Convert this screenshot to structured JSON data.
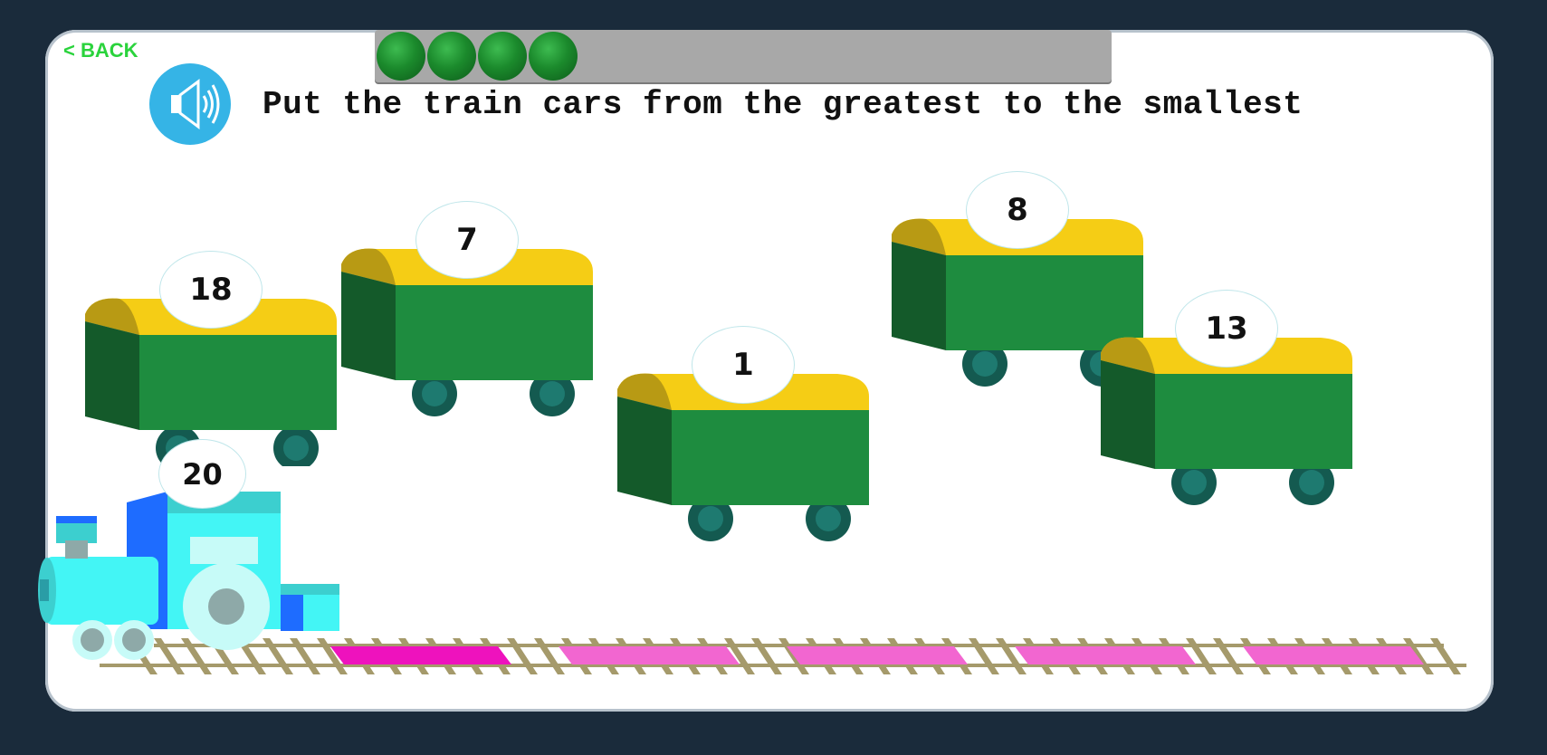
{
  "nav": {
    "back_label": "< BACK"
  },
  "progress": {
    "completed": 4
  },
  "instruction": "Put the train cars from the greatest to the smallest",
  "engine": {
    "number": "20"
  },
  "cars": [
    {
      "number": "18"
    },
    {
      "number": "7"
    },
    {
      "number": "1"
    },
    {
      "number": "8"
    },
    {
      "number": "13"
    }
  ],
  "slots": {
    "count": 5,
    "filled": 1
  },
  "colors": {
    "background": "#1a2b3b",
    "car_body": "#1e8c3f",
    "car_side": "#145a2a",
    "car_roof": "#f5cd15",
    "slot_active": "#ee12bd",
    "slot": "#f266d0",
    "back_text": "#2ad33c"
  }
}
